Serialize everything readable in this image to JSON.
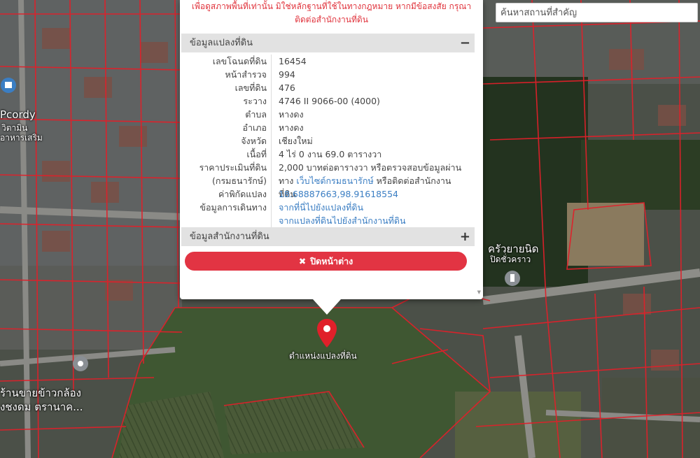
{
  "map": {
    "marker_label": "ตำแหน่งแปลงที่ดิน",
    "place_labels": [
      "Pcordy",
      "วิตามิน",
      "อาหารเสริม",
      "ครัวยายนิด",
      "ปิดชั่วคราว",
      "ร้านขายข้าวกล้อง",
      "งชงดม ตรานาค..."
    ],
    "colors": {
      "parcel_line": "#e0202a",
      "marker": "#e0202a"
    }
  },
  "search": {
    "placeholder": "ค้นหาสถานที่สำคัญ"
  },
  "popup": {
    "warning_line1": "เพื่อดูสภาพพื้นที่เท่านั้น มิใช่หลักฐานที่ใช้ในทางกฎหมาย หากมีข้อสงสัย กรุณา",
    "warning_line2": "ติดต่อสำนักงานที่ดิน",
    "section1_title": "ข้อมูลแปลงที่ดิน",
    "section1_toggle": "−",
    "section2_title": "ข้อมูลสำนักงานที่ดิน",
    "section2_toggle": "+",
    "rows": [
      {
        "label": "เลขโฉนดที่ดิน",
        "value": "16454"
      },
      {
        "label": "หน้าสำรวจ",
        "value": "994"
      },
      {
        "label": "เลขที่ดิน",
        "value": "476"
      },
      {
        "label": "ระวาง",
        "value": "4746 II 9066-00 (4000)"
      },
      {
        "label": "ตำบล",
        "value": "หางดง"
      },
      {
        "label": "อำเภอ",
        "value": "หางดง"
      },
      {
        "label": "จังหวัด",
        "value": "เชียงใหม่"
      },
      {
        "label": "เนื้อที่",
        "value": "4 ไร่ 0 งาน 69.0 ตารางวา"
      }
    ],
    "price_label": "ราคาประเมินที่ดิน",
    "price_label2": "(กรมธนารักษ์)",
    "price_text1": "2,000 บาทต่อตารางวา หรือตรวจสอบข้อมูลผ่าน",
    "price_text2_prefix": "ทาง ",
    "price_link": "เว็บไซต์กรมธนารักษ์",
    "price_text2_suffix": " หรือติดต่อสำนักงานที่ดิน",
    "coord_label": "ค่าพิกัดแปลง",
    "coord_value": "18.68887663,98.91618554",
    "route_label": "ข้อมูลการเดินทาง",
    "route_link1": "จากที่นี่ไปยังแปลงที่ดิน",
    "route_link2": "จากแปลงที่ดินไปยังสำนักงานที่ดิน",
    "close_label": "ปิดหน้าต่าง",
    "close_icon": "times-icon"
  }
}
